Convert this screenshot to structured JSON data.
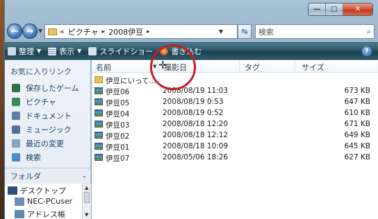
{
  "address": {
    "path": [
      "«",
      "ピクチャ",
      "2008伊豆"
    ]
  },
  "search": {
    "placeholder": "検索"
  },
  "toolbar": {
    "organize": "整理",
    "views": "表示",
    "slideshow": "スライドショー",
    "burn": "書き込む"
  },
  "sidebar": {
    "title": "お気に入りリンク",
    "items": [
      {
        "label": "保存したゲーム",
        "icon": "saved-games-icon"
      },
      {
        "label": "ピクチャ",
        "icon": "pictures-icon"
      },
      {
        "label": "ドキュメント",
        "icon": "documents-icon"
      },
      {
        "label": "ミュージック",
        "icon": "music-icon"
      },
      {
        "label": "最近の変更",
        "icon": "recent-changes-icon"
      },
      {
        "label": "検索",
        "icon": "search-folder-icon"
      }
    ],
    "folders_label": "フォルダ",
    "tree": [
      {
        "label": "デスクトップ"
      },
      {
        "label": "NEC-PCuser"
      },
      {
        "label": "アドレス帳"
      }
    ]
  },
  "columns": {
    "name": "名前",
    "date": "撮影日",
    "tags": "タグ",
    "size": "サイズ"
  },
  "files": [
    {
      "name": "伊豆にいって...",
      "date": "",
      "size": "",
      "type": "folder"
    },
    {
      "name": "伊豆06",
      "date": "2008/08/19 11:03",
      "size": "673 KB",
      "type": "image"
    },
    {
      "name": "伊豆05",
      "date": "2008/08/19 0:53",
      "size": "647 KB",
      "type": "image"
    },
    {
      "name": "伊豆04",
      "date": "2008/08/19 0:52",
      "size": "610 KB",
      "type": "image"
    },
    {
      "name": "伊豆03",
      "date": "2008/08/18 12:20",
      "size": "671 KB",
      "type": "image"
    },
    {
      "name": "伊豆02",
      "date": "2008/08/18 12:12",
      "size": "649 KB",
      "type": "image"
    },
    {
      "name": "伊豆01",
      "date": "2008/08/18 10:09",
      "size": "645 KB",
      "type": "image"
    },
    {
      "name": "伊豆07",
      "date": "2008/05/06 18:26",
      "size": "627 KB",
      "type": "image"
    }
  ],
  "colors": {
    "accent": "#2d5767",
    "annotation": "#c81e1e"
  }
}
